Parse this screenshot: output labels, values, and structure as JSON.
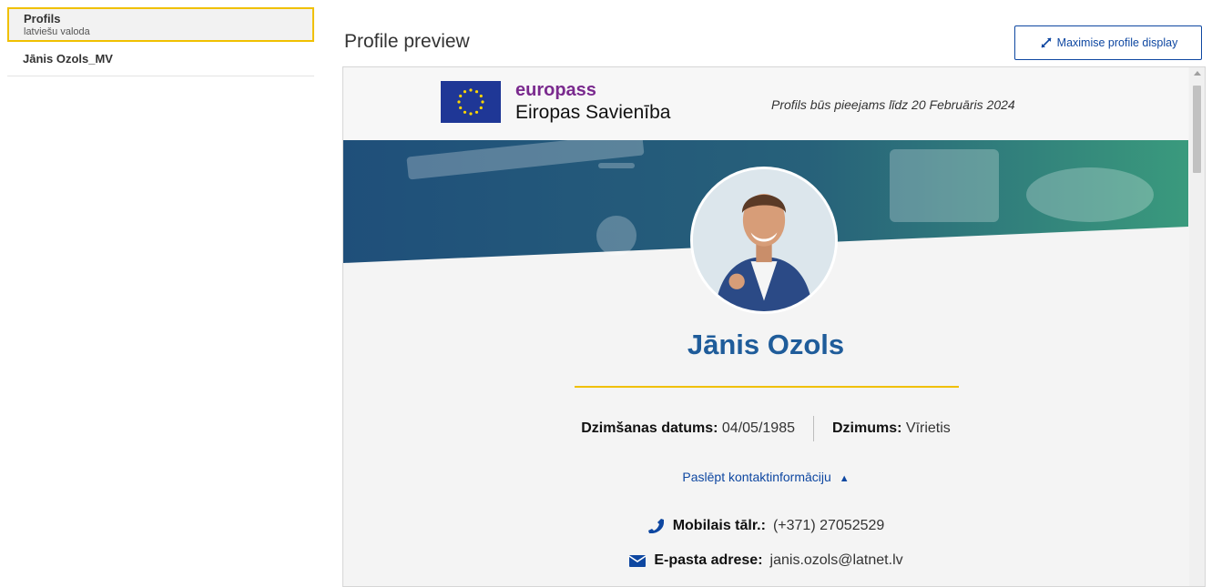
{
  "sidebar": {
    "items": [
      {
        "title": "Profils",
        "subtitle": "latviešu valoda"
      },
      {
        "title": "Jānis Ozols_MV"
      }
    ]
  },
  "header": {
    "title": "Profile preview",
    "maximise_label": "Maximise profile display"
  },
  "profile": {
    "brand": "europass",
    "union": "Eiropas Savienība",
    "availability": "Profils būs pieejams līdz 20 Februāris 2024",
    "name": "Jānis Ozols",
    "birth_label": "Dzimšanas datums:",
    "birth_value": "04/05/1985",
    "gender_label": "Dzimums:",
    "gender_value": "Vīrietis",
    "toggle_label": "Paslēpt kontaktinformāciju",
    "phone_label": "Mobilais tālr.:",
    "phone_value": "(+371) 27052529",
    "email_label": "E-pasta adrese:",
    "email_value": "janis.ozols@latnet.lv"
  },
  "colors": {
    "accent": "#0e47a1",
    "gold": "#f0c000",
    "brand_purple": "#7a2a8e",
    "name_blue": "#1f5c9a"
  }
}
